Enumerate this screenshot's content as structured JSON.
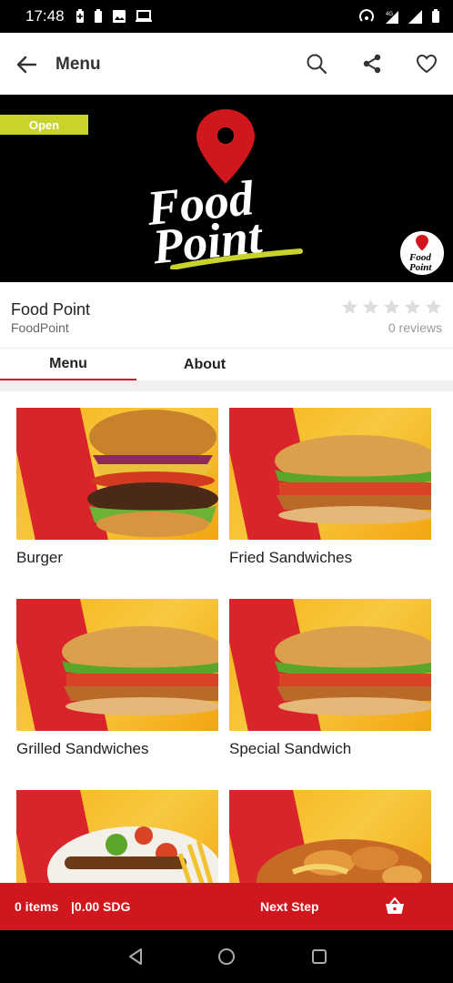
{
  "status": {
    "time": "17:48",
    "left_icons": [
      "battery-saver-icon",
      "battery-icon",
      "image-icon",
      "laptop-icon"
    ],
    "right_icons": [
      "hotspot-icon",
      "network-4g-icon",
      "signal-icon",
      "battery-icon"
    ]
  },
  "app_bar": {
    "title": "Menu",
    "actions": [
      "search-icon",
      "share-icon",
      "favorite-icon"
    ]
  },
  "banner": {
    "status_badge": "Open",
    "logo_text_line1": "Food",
    "logo_text_line2": "Point",
    "colors": {
      "badge": "#c8d42c",
      "pin": "#d0171d",
      "swoosh": "#c8d42c"
    }
  },
  "store": {
    "name": "Food Point",
    "handle": "FoodPoint",
    "rating_stars": 0,
    "reviews": "0 reviews"
  },
  "tabs": [
    {
      "label": "Menu",
      "active": true
    },
    {
      "label": "About",
      "active": false
    }
  ],
  "categories": [
    {
      "title": "Burger",
      "image": "burger"
    },
    {
      "title": "Fried Sandwiches",
      "image": "sandwich"
    },
    {
      "title": "Grilled Sandwiches",
      "image": "sandwich"
    },
    {
      "title": "Special Sandwich",
      "image": "sandwich"
    },
    {
      "title": "",
      "image": "grill-plate"
    },
    {
      "title": "",
      "image": "fries-plate"
    }
  ],
  "cart": {
    "items": "0 items",
    "total": "|0.00 SDG",
    "next_label": "Next Step"
  },
  "colors": {
    "accent": "#d0171d",
    "card_bg": "#f6b21b"
  }
}
